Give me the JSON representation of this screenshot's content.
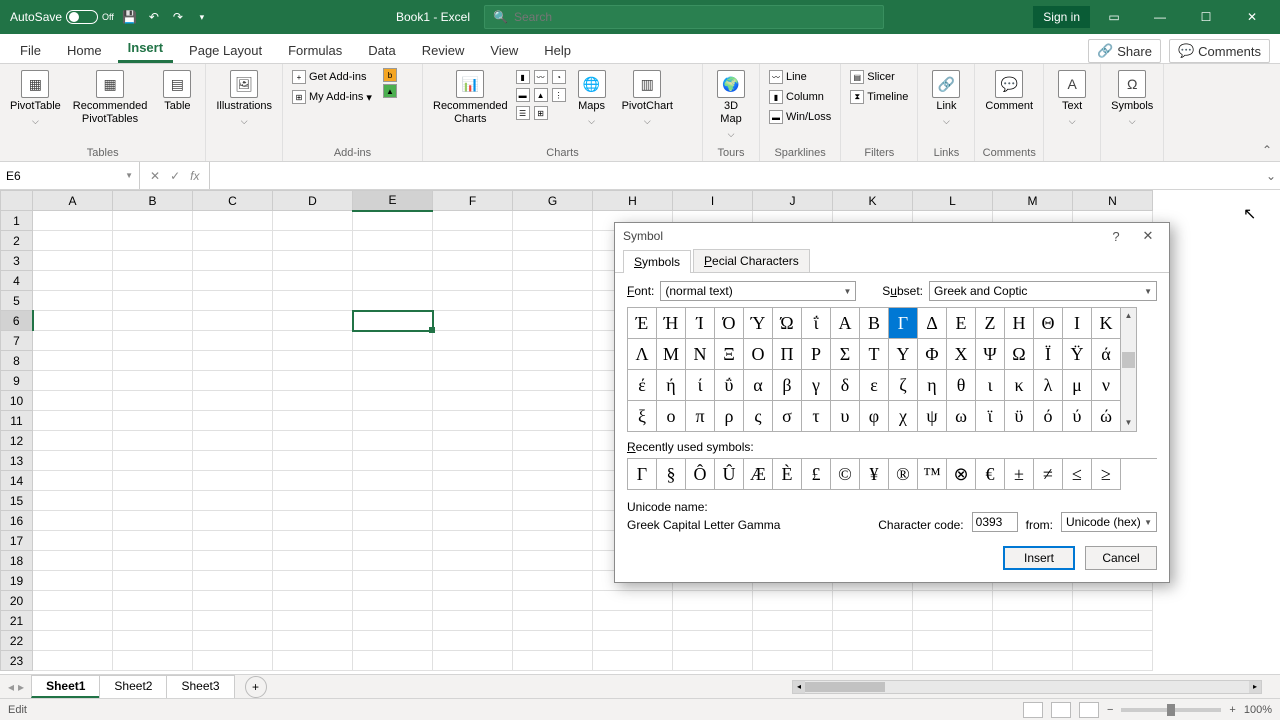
{
  "titlebar": {
    "autosave": "AutoSave",
    "autosave_state": "Off",
    "doc_title": "Book1 - Excel",
    "search_placeholder": "Search",
    "signin": "Sign in"
  },
  "tabs": [
    "File",
    "Home",
    "Insert",
    "Page Layout",
    "Formulas",
    "Data",
    "Review",
    "View",
    "Help"
  ],
  "active_tab": "Insert",
  "share": "Share",
  "comments": "Comments",
  "ribbon": {
    "tables": {
      "label": "Tables",
      "pivottable": "PivotTable",
      "rec_pivottables": "Recommended\nPivotTables",
      "table": "Table"
    },
    "illustrations": {
      "label": "Illustrations",
      "btn": "Illustrations"
    },
    "addins": {
      "label": "Add-ins",
      "get": "Get Add-ins",
      "my": "My Add-ins"
    },
    "charts": {
      "label": "Charts",
      "rec": "Recommended\nCharts",
      "maps": "Maps",
      "pivotchart": "PivotChart"
    },
    "tours": {
      "label": "Tours",
      "map3d": "3D\nMap"
    },
    "sparklines": {
      "label": "Sparklines",
      "line": "Line",
      "column": "Column",
      "winloss": "Win/Loss"
    },
    "filters": {
      "label": "Filters",
      "slicer": "Slicer",
      "timeline": "Timeline"
    },
    "links": {
      "label": "Links",
      "link": "Link"
    },
    "cmts": {
      "label": "Comments",
      "comment": "Comment"
    },
    "text": {
      "label": "Text",
      "btn": "Text"
    },
    "symbols": {
      "label": "Symbols",
      "btn": "Symbols"
    }
  },
  "namebox": "E6",
  "columns": [
    "A",
    "B",
    "C",
    "D",
    "E",
    "F",
    "G",
    "H",
    "I",
    "J",
    "K",
    "L",
    "M",
    "N"
  ],
  "rows_count": 23,
  "selected_cell": {
    "row": 6,
    "col": "E"
  },
  "sheets": [
    "Sheet1",
    "Sheet2",
    "Sheet3"
  ],
  "active_sheet": "Sheet1",
  "status_mode": "Edit",
  "zoom": "100%",
  "dialog": {
    "title": "Symbol",
    "tabs": {
      "symbols": "Symbols",
      "special": "Special Characters"
    },
    "font_label": "Font:",
    "font_value": "(normal text)",
    "subset_label": "Subset:",
    "subset_value": "Greek and Coptic",
    "symbols_grid": [
      [
        "Έ",
        "Ή",
        "Ί",
        "Ό",
        "Ύ",
        "Ώ",
        "ΐ",
        "Α",
        "Β",
        "Γ",
        "Δ",
        "Ε",
        "Ζ",
        "Η",
        "Θ",
        "Ι",
        "Κ"
      ],
      [
        "Λ",
        "Μ",
        "Ν",
        "Ξ",
        "Ο",
        "Π",
        "Ρ",
        "Σ",
        "Τ",
        "Υ",
        "Φ",
        "Χ",
        "Ψ",
        "Ω",
        "Ϊ",
        "Ϋ",
        "ά"
      ],
      [
        "έ",
        "ή",
        "ί",
        "ΰ",
        "α",
        "β",
        "γ",
        "δ",
        "ε",
        "ζ",
        "η",
        "θ",
        "ι",
        "κ",
        "λ",
        "μ",
        "ν"
      ],
      [
        "ξ",
        "ο",
        "π",
        "ρ",
        "ς",
        "σ",
        "τ",
        "υ",
        "φ",
        "χ",
        "ψ",
        "ω",
        "ϊ",
        "ϋ",
        "ό",
        "ύ",
        "ώ"
      ]
    ],
    "selected_index": [
      0,
      9
    ],
    "recent_label": "Recently used symbols:",
    "recent": [
      "Γ",
      "§",
      "Ô",
      "Û",
      "Æ",
      "È",
      "£",
      "©",
      "¥",
      "®",
      "™",
      "⊗",
      "€",
      "±",
      "≠",
      "≤",
      "≥"
    ],
    "unicode_name_label": "Unicode name:",
    "unicode_name": "Greek Capital Letter Gamma",
    "charcode_label": "Character code:",
    "charcode": "0393",
    "from_label": "from:",
    "from_value": "Unicode (hex)",
    "insert": "Insert",
    "cancel": "Cancel"
  }
}
